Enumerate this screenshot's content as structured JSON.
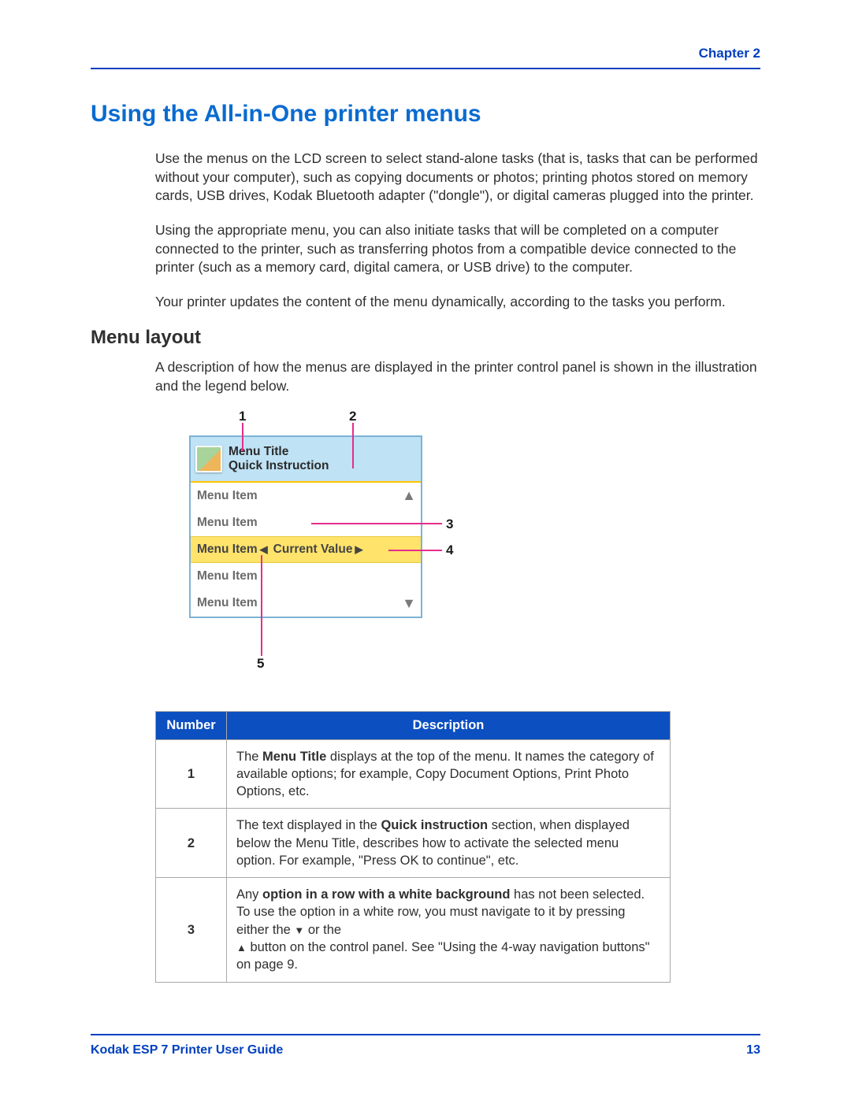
{
  "header": {
    "chapter_label": "Chapter 2"
  },
  "section": {
    "title": "Using the All-in-One printer menus",
    "paragraphs": [
      "Use the menus on the LCD screen to select stand-alone tasks (that is, tasks that can be performed without your computer), such as copying documents or photos; printing photos stored on memory cards, USB drives, Kodak Bluetooth adapter (\"dongle\"), or digital cameras plugged into the printer.",
      "Using the appropriate menu, you can also initiate tasks that will be completed on a computer connected to the printer, such as transferring photos from a compatible device connected to the printer (such as a memory card, digital camera, or USB drive) to the computer.",
      "Your printer updates the content of the menu dynamically, according to the tasks you perform."
    ]
  },
  "subsection": {
    "title": "Menu layout",
    "paragraph": "A description of how the menus are displayed in the printer control panel is shown in the illustration and the legend below."
  },
  "menu_illustration": {
    "header_title": "Menu Title",
    "header_instruction": "Quick Instruction",
    "items": [
      "Menu Item",
      "Menu Item",
      "Menu Item",
      "Menu Item",
      "Menu Item"
    ],
    "selected_index": 2,
    "current_value_label": "Current Value",
    "callouts": {
      "1": "1",
      "2": "2",
      "3": "3",
      "4": "4",
      "5": "5"
    }
  },
  "legend": {
    "headers": [
      "Number",
      "Description"
    ],
    "rows": [
      {
        "num": "1",
        "desc_pre": "The ",
        "desc_bold": "Menu Title",
        "desc_post": " displays at the top of the menu. It names the category of available options; for example, Copy Document Options, Print Photo Options, etc."
      },
      {
        "num": "2",
        "desc_pre": "The text displayed in the ",
        "desc_bold": "Quick instruction",
        "desc_post": " section, when displayed below the Menu Title, describes how to activate the selected menu option. For example, \"Press OK to continue\", etc."
      },
      {
        "num": "3",
        "desc_pre": "Any ",
        "desc_bold": "option in a row with a white background",
        "desc_post_a": " has not been selected. To use the option in a white row, you must navigate to it by pressing either the ",
        "desc_post_b": " or the ",
        "desc_post_c": " button on the control panel. See \"Using the 4-way navigation buttons\" on page 9."
      }
    ]
  },
  "footer": {
    "guide_name": "Kodak ESP 7 Printer User Guide",
    "page_number": "13"
  }
}
